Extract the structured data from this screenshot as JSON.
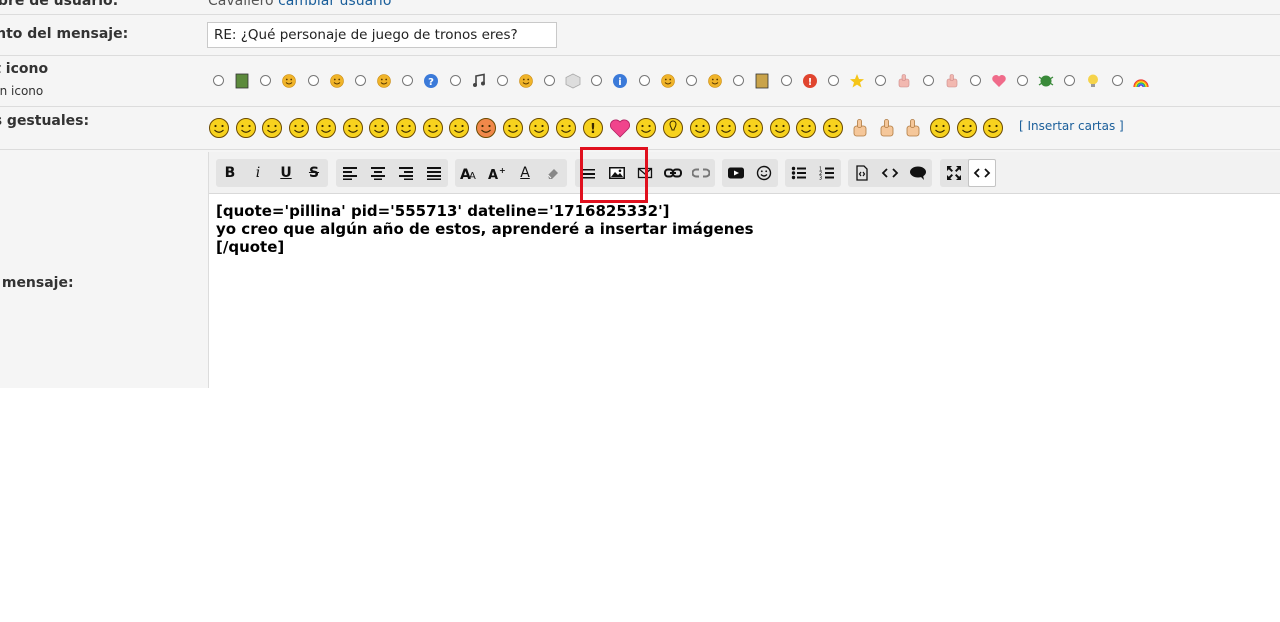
{
  "form": {
    "username_label": "Nombre de usuario:",
    "username_value": "Cavallero",
    "change_user_link": "cambiar usuario",
    "subject_label": "Asunto del mensaje:",
    "subject_value": "RE: ¿Qué personaje de juego de tronos eres?",
    "post_icon_label": "Post icono",
    "no_icon_label": "sin icono",
    "smilies_label": "Iconos gestuales:",
    "insert_cards_link": "[ Insertar cartas ]",
    "message_label": "Tu mensaje:"
  },
  "post_icons": [
    "film-icon",
    "grin-icon",
    "smile-icon",
    "wink-icon",
    "question-icon",
    "music-icon",
    "tongue-icon",
    "cube-icon",
    "info-icon",
    "biggrin-icon",
    "happy-icon",
    "picture-icon",
    "exclamation-icon",
    "star-icon",
    "thumbsup-icon",
    "thumbsdown-icon",
    "heart-icon",
    "bug-icon",
    "lightbulb-icon",
    "rainbow-icon"
  ],
  "smilies": [
    "smile",
    "grin",
    "cool",
    "laugh",
    "tongue",
    "big-eyes",
    "nerd",
    "worried",
    "scream",
    "angel",
    "angry",
    "wink",
    "dizzy",
    "smug",
    "exclamation",
    "heart",
    "confused",
    "idea",
    "relieved",
    "sly",
    "sleepy",
    "dazed",
    "tired",
    "crying",
    "thumbs-up",
    "thumbs-down",
    "ok-hand",
    "kiss",
    "heart-eyes",
    "blush"
  ],
  "toolbar": {
    "bold": "B",
    "italic": "i",
    "underline": "U",
    "strike": "S",
    "font_color": "A"
  },
  "editor": {
    "content": "[quote='pillina' pid='555713' dateline='1716825332']\nyo creo que algún año de estos, aprenderé a insertar imágenes\n[/quote]"
  },
  "colors": {
    "link": "#1a5e9a",
    "highlight": "#e0101e",
    "row_bg": "#f5f5f5"
  }
}
